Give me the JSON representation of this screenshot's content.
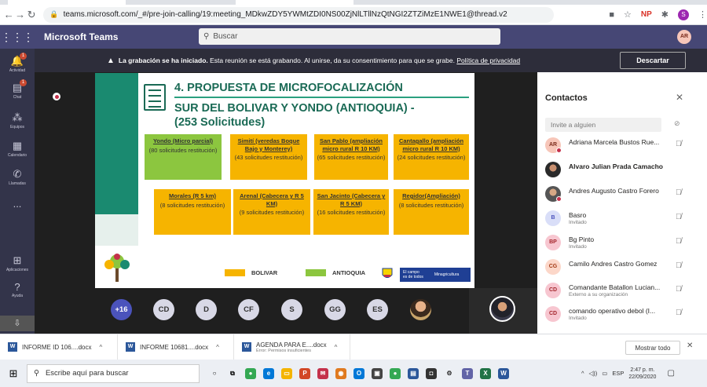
{
  "browser": {
    "url": "teams.microsoft.com/_#/pre-join-calling/19:meeting_MDkwZDY5YWMtZDI0NS00ZjNlLTllNzQtNGI2ZTZiMzE1NWE1@thread.v2",
    "profile_initial": "S",
    "ext_np": "NP"
  },
  "teams": {
    "app_name": "Microsoft Teams",
    "search_placeholder": "Buscar",
    "user_initials": "AR"
  },
  "rail": [
    {
      "label": "Actividad",
      "badge": "1"
    },
    {
      "label": "Chat",
      "badge": "1"
    },
    {
      "label": "Equipos",
      "badge": ""
    },
    {
      "label": "Calendario",
      "badge": ""
    },
    {
      "label": "Llamadas",
      "badge": ""
    },
    {
      "label": "...",
      "badge": ""
    },
    {
      "label": "Aplicaciones",
      "badge": ""
    },
    {
      "label": "Ayuda",
      "badge": ""
    }
  ],
  "banner": {
    "bold": "La grabación se ha iniciado.",
    "text": " Esta reunión se está grabando. Al unirse, da su consentimiento para que se grabe. ",
    "link": "Política de privacidad",
    "button": "Descartar"
  },
  "slide": {
    "title1": "4. PROPUESTA DE MICROFOCALIZACIÓN",
    "title2a": "SUR DEL BOLIVAR Y YONDO (ANTIOQUIA) -",
    "title2b": "(253 Solicitudes)",
    "cards": [
      {
        "name": "Yondo (Micro parcial)",
        "detail": "(80 solicitudes restitución)",
        "region": "antioquia"
      },
      {
        "name": "Simití (veredas Boque Bajo y Monterey)",
        "detail": "(43 solicitudes restitución)",
        "region": "bolivar"
      },
      {
        "name": "San Pablo (ampliación micro rural R 10 KM)",
        "detail": "(65 solicitudes restitución)",
        "region": "bolivar"
      },
      {
        "name": "Cantagallo (ampliación micro rural R 10 KM)",
        "detail": "(24 solicitudes restitución)",
        "region": "bolivar"
      },
      {
        "name": "Morales (R 5 km)",
        "detail": "(8 solicitudes restitución)",
        "region": "bolivar"
      },
      {
        "name": "Arenal (Cabecera y R 5 KM)",
        "detail": "(9 solicitudes restitución)",
        "region": "bolivar"
      },
      {
        "name": "San Jacinto (Cabecera y R 5 KM)",
        "detail": "(16 solicitudes restitución)",
        "region": "bolivar"
      },
      {
        "name": "Regidor(Ampliación)",
        "detail": "(8 solicitudes restitución)",
        "region": "bolivar"
      }
    ],
    "legend_bolivar": "BOLIVAR",
    "legend_antioquia": "ANTIOQUIA",
    "campo_line1": "El campo",
    "campo_line2": "es de todos",
    "campo_ministry": "Minagricultura",
    "colors": {
      "bolivar": "#f6b400",
      "antioquia": "#8cc63f",
      "accent": "#1a8a70"
    }
  },
  "participants": [
    "+16",
    "CD",
    "D",
    "CF",
    "S",
    "GG",
    "ES"
  ],
  "contacts_panel": {
    "title": "Contactos",
    "invite_placeholder": "Invite a alguien",
    "contacts": [
      {
        "initials": "AR",
        "name": "Adriana Marcela Bustos Rue...",
        "status": "",
        "bold": false,
        "bg": "#f7c6b9",
        "fg": "#7a2a1a",
        "dot": "#c4314b"
      },
      {
        "initials": "",
        "name": "Alvaro Julian Prada Camacho",
        "status": "",
        "bold": true,
        "bg": "#3b2a1e",
        "fg": "#fff",
        "dot": ""
      },
      {
        "initials": "",
        "name": "Andres Augusto Castro Forero",
        "status": "",
        "bold": false,
        "bg": "#5a4a3e",
        "fg": "#fff",
        "dot": "#c4314b"
      },
      {
        "initials": "B",
        "name": "Basro",
        "status": "Invitado",
        "bold": false,
        "bg": "#d9def8",
        "fg": "#4b53bc",
        "dot": ""
      },
      {
        "initials": "BP",
        "name": "Bg Pinto",
        "status": "Invitado",
        "bold": false,
        "bg": "#f7c6d0",
        "fg": "#a4262c",
        "dot": ""
      },
      {
        "initials": "CG",
        "name": "Camilo Andres Castro Gomez",
        "status": "",
        "bold": false,
        "bg": "#fcd7c9",
        "fg": "#a33b16",
        "dot": ""
      },
      {
        "initials": "CD",
        "name": "Comandante Batallon Lucian...",
        "status": "Externo a su organización",
        "bold": false,
        "bg": "#f7c6d0",
        "fg": "#a4262c",
        "dot": ""
      },
      {
        "initials": "CD",
        "name": "comando operativo debol (I...",
        "status": "Invitado",
        "bold": false,
        "bg": "#f7c6d0",
        "fg": "#a4262c",
        "dot": ""
      }
    ]
  },
  "downloads": [
    {
      "name": "INFORME ID 106....docx",
      "sub": ""
    },
    {
      "name": "INFORME 10681....docx",
      "sub": ""
    },
    {
      "name": "AGENDA PARA E....docx",
      "sub": "Error: Permisos insuficientes"
    }
  ],
  "downloads_show_all": "Mostrar todo",
  "taskbar": {
    "search_placeholder": "Escribe aquí para buscar",
    "lang": "ESP",
    "time": "2:47 p. m.",
    "date": "22/09/2020"
  }
}
